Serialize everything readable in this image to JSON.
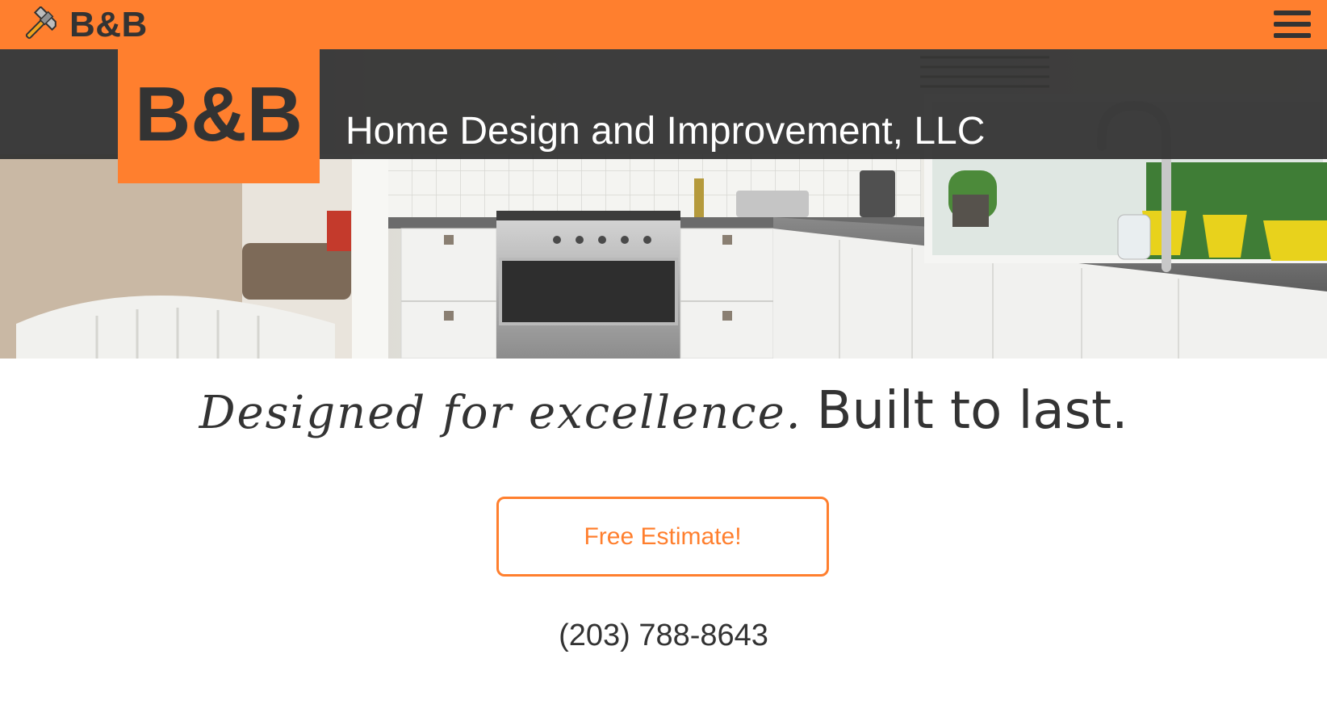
{
  "navbar": {
    "brand_icon": "hammer-icon",
    "brand_text": "B&B",
    "menu_icon": "hamburger-menu-icon",
    "background_color": "#ff7f2e"
  },
  "hero": {
    "logo_text": "B&B",
    "company_name": "Home Design and Improvement, LLC",
    "logo_color": "#ff7f2e",
    "band_color": "#343434"
  },
  "tagline": {
    "script_text": "Designed for excellence.",
    "bold_text": "Built to last."
  },
  "cta": {
    "label": "Free Estimate!",
    "accent_color": "#ff7f2e"
  },
  "contact": {
    "phone": "(203) 788-8643"
  }
}
